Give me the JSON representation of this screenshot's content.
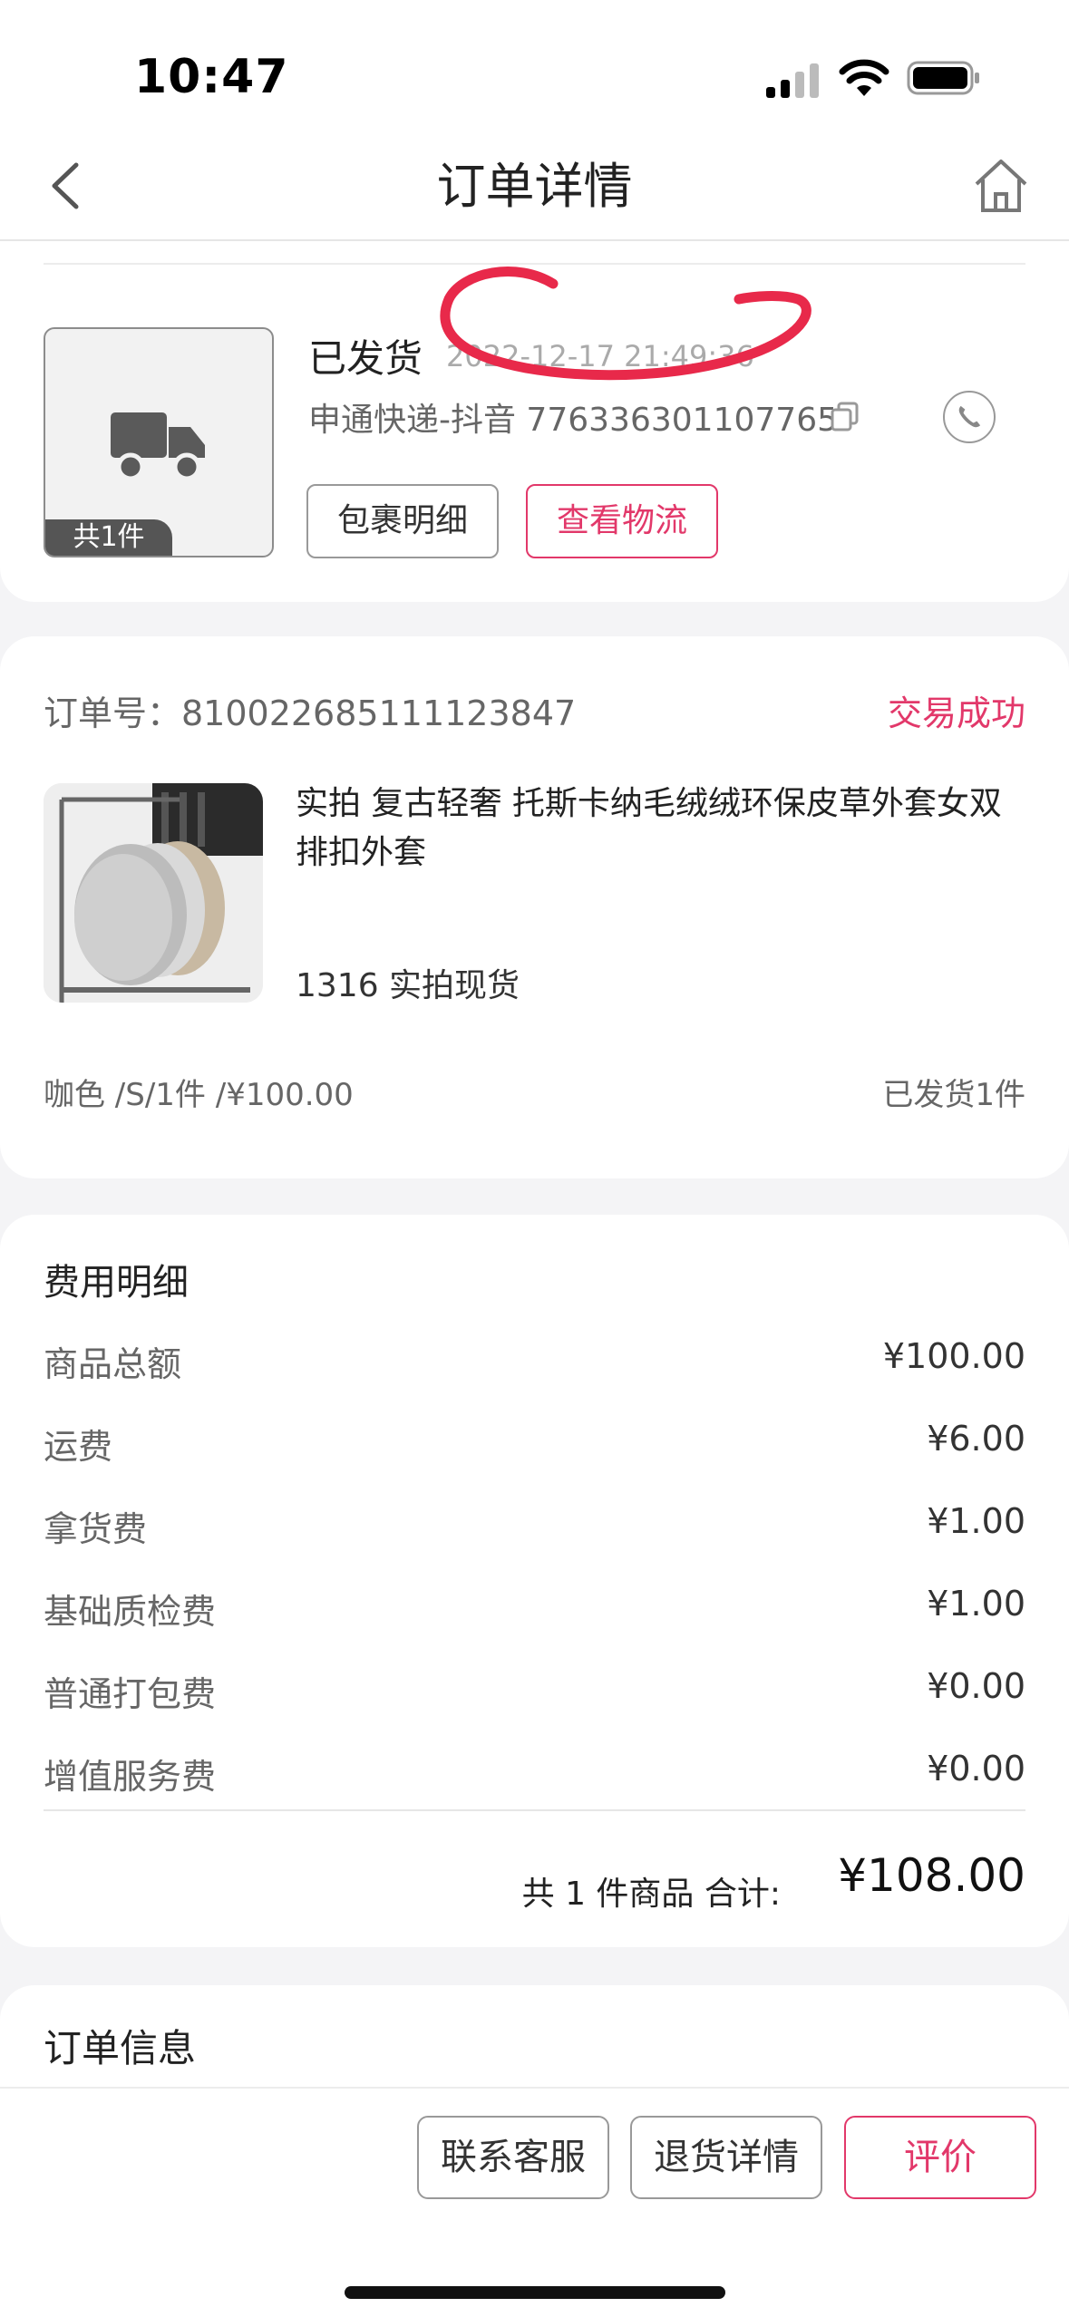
{
  "status_bar": {
    "time": "10:47"
  },
  "nav": {
    "title": "订单详情"
  },
  "shipment": {
    "count_tag": "共1件",
    "status": "已发货",
    "time": "2022-12-17 21:49:36",
    "tracking": "申通快递-抖音 776336301107765",
    "parcel_button": "包裹明细",
    "logistics_button": "查看物流"
  },
  "order": {
    "order_no": "订单号：810022685111123847",
    "status": "交易成功",
    "product_name": "实拍 复古轻奢 托斯卡纳毛绒绒环保皮草外套女双排扣外套",
    "product_code": "1316 实拍现货",
    "spec": "咖色 /S/1件 /¥100.00",
    "shipped": "已发货1件"
  },
  "fees": {
    "title": "费用明细",
    "rows": [
      {
        "label": "商品总额",
        "value": "¥100.00"
      },
      {
        "label": "运费",
        "value": "¥6.00"
      },
      {
        "label": "拿货费",
        "value": "¥1.00"
      },
      {
        "label": "基础质检费",
        "value": "¥1.00"
      },
      {
        "label": "普通打包费",
        "value": "¥0.00"
      },
      {
        "label": "增值服务费",
        "value": "¥0.00"
      }
    ],
    "total_label": "共 1 件商品  合计:",
    "total": "¥108.00"
  },
  "order_info": {
    "title": "订单信息"
  },
  "bottom_bar": {
    "service_button": "联系客服",
    "return_button": "退货详情",
    "review_button": "评价"
  },
  "colors": {
    "accent": "#e2386a",
    "annotation": "#e8294a"
  }
}
